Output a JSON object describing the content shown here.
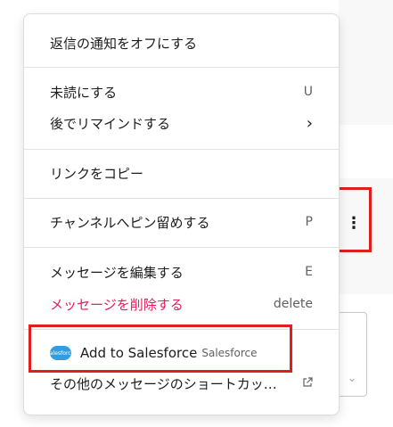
{
  "menu": {
    "items": [
      {
        "label": "返信の通知をオフにする"
      },
      {
        "label": "未読にする",
        "shortcut": "U"
      },
      {
        "label": "後でリマインドする",
        "shortcut": "›"
      },
      {
        "label": "リンクをコピー"
      },
      {
        "label": "チャンネルへピン留めする",
        "shortcut": "P"
      },
      {
        "label": "メッセージを編集する",
        "shortcut": "E"
      },
      {
        "label": "メッセージを削除する",
        "shortcut": "delete"
      }
    ],
    "salesforce": {
      "title": "Add to Salesforce",
      "subtitle": "Salesforce",
      "logo_text": "salesforce"
    },
    "more_shortcuts": "その他のメッセージのショートカッ…",
    "more_shortcuts_icon": "external-link-icon"
  },
  "message_actions": {
    "more_icon": "⋮"
  },
  "colors": {
    "danger": "#e01e5a",
    "highlight": "#e01e1e",
    "salesforce_blue": "#2e9ee0"
  }
}
